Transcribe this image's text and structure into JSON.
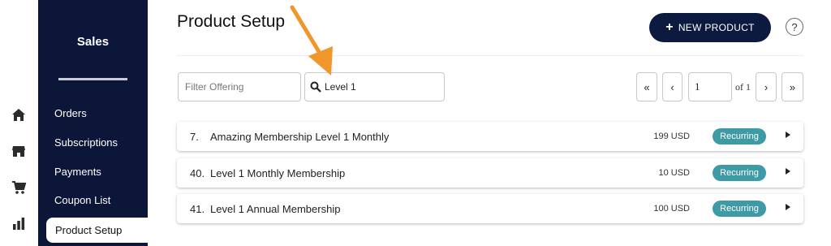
{
  "rail": {
    "icons": [
      "home-icon",
      "store-icon",
      "cart-icon",
      "bar-chart-icon"
    ]
  },
  "sidebar": {
    "title": "Sales",
    "items": [
      {
        "label": "Orders"
      },
      {
        "label": "Subscriptions"
      },
      {
        "label": "Payments"
      },
      {
        "label": "Coupon List"
      },
      {
        "label": "Product Setup",
        "active": true
      }
    ]
  },
  "header": {
    "title": "Product Setup",
    "new_button_label": "NEW PRODUCT",
    "help_label": "?"
  },
  "filters": {
    "offering_placeholder": "Filter Offering",
    "search_value": "Level 1"
  },
  "pagination": {
    "first": "«",
    "prev": "‹",
    "page": "1",
    "of": "of 1",
    "next": "›",
    "last": "»"
  },
  "products": [
    {
      "num": "7.",
      "name": "Amazing Membership Level 1 Monthly",
      "price": "199 USD",
      "badge": "Recurring"
    },
    {
      "num": "40.",
      "name": "Level 1 Monthly Membership",
      "price": "10 USD",
      "badge": "Recurring"
    },
    {
      "num": "41.",
      "name": "Level 1 Annual Membership",
      "price": "100 USD",
      "badge": "Recurring"
    }
  ],
  "colors": {
    "sidebar_bg": "#0c1638",
    "primary_button": "#0d1a3f",
    "badge_bg": "#3e9aa4",
    "annotation_arrow": "#f0962a"
  }
}
